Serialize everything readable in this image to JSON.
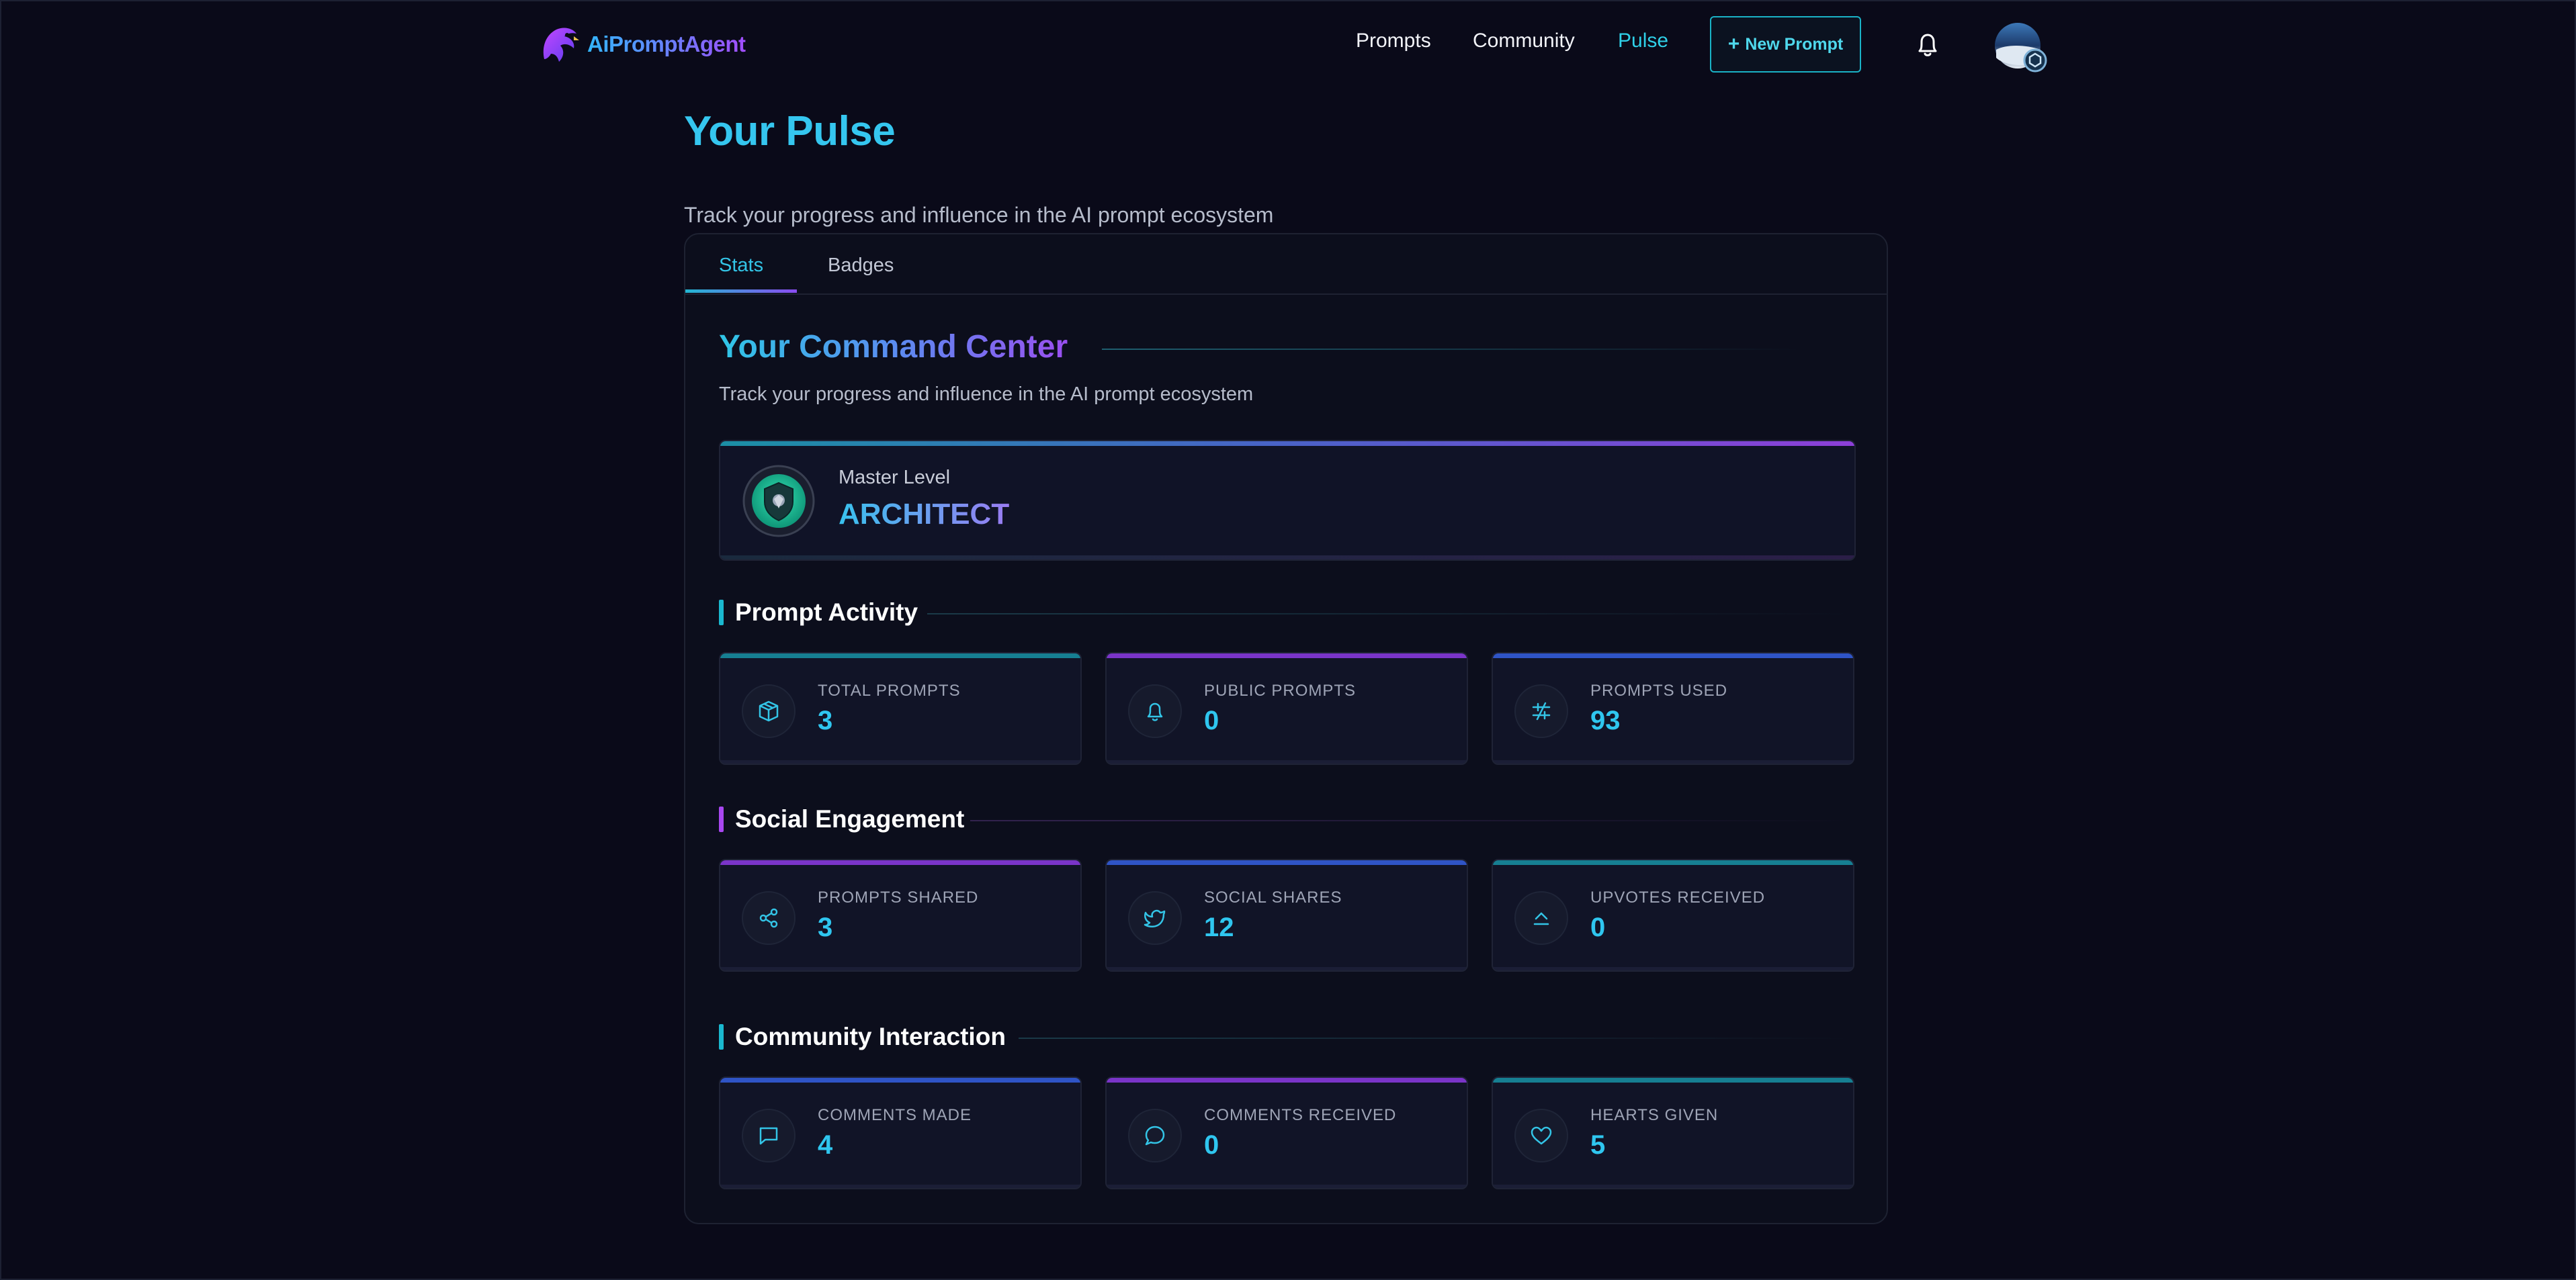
{
  "nav": {
    "logo_text": "AiPromptAgent",
    "links": [
      "Prompts",
      "Community",
      "Pulse"
    ],
    "new_prompt_label": "New Prompt"
  },
  "page": {
    "title": "Your Pulse",
    "subtitle": "Track your progress and influence in the AI prompt ecosystem"
  },
  "tabs": [
    "Stats",
    "Badges"
  ],
  "command_center": {
    "title": "Your Command Center",
    "subtitle": "Track your progress and influence in the AI prompt ecosystem",
    "level_label": "Master Level",
    "level_name": "ARCHITECT"
  },
  "sections": [
    {
      "title": "Prompt Activity",
      "stats": [
        {
          "label": "TOTAL PROMPTS",
          "value": "3",
          "icon": "cube-icon"
        },
        {
          "label": "PUBLIC PROMPTS",
          "value": "0",
          "icon": "bell-icon"
        },
        {
          "label": "PROMPTS USED",
          "value": "93",
          "icon": "sliders-icon"
        }
      ]
    },
    {
      "title": "Social Engagement",
      "stats": [
        {
          "label": "PROMPTS SHARED",
          "value": "3",
          "icon": "share-icon"
        },
        {
          "label": "SOCIAL SHARES",
          "value": "12",
          "icon": "twitter-icon"
        },
        {
          "label": "UPVOTES RECEIVED",
          "value": "0",
          "icon": "upvote-icon"
        }
      ]
    },
    {
      "title": "Community Interaction",
      "stats": [
        {
          "label": "COMMENTS MADE",
          "value": "4",
          "icon": "comment-icon"
        },
        {
          "label": "COMMENTS RECEIVED",
          "value": "0",
          "icon": "comment-round-icon"
        },
        {
          "label": "HEARTS GIVEN",
          "value": "5",
          "icon": "heart-icon"
        }
      ]
    }
  ],
  "colors": {
    "background": "#0a0a19",
    "accent_cyan": "#2fc6ef",
    "accent_purple": "#9a4ff0",
    "accent_blue": "#3a5fd0"
  }
}
